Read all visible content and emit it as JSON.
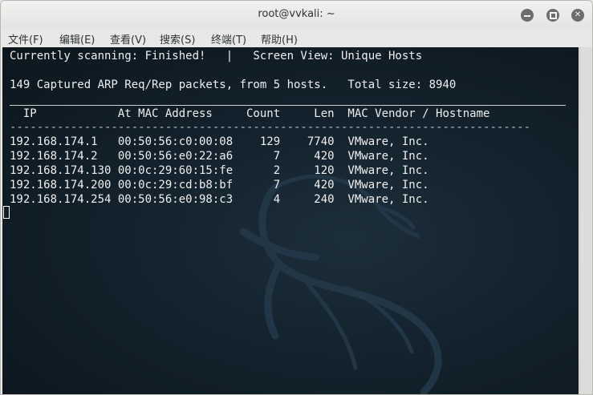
{
  "window": {
    "title": "root@vvkali: ~"
  },
  "menu": [
    "文件(F)",
    "编辑(E)",
    "查看(V)",
    "搜索(S)",
    "终端(T)",
    "帮助(H)"
  ],
  "terminal": {
    "status_line": "Currently scanning: Finished!   |   Screen View: Unique Hosts",
    "summary_line": "149 Captured ARP Req/Rep packets, from 5 hosts.   Total size: 8940",
    "header_line": "  IP            At MAC Address     Count     Len  MAC Vendor / Hostname",
    "dash_line": "-----------------------------------------------------------------------------",
    "rows": [
      "192.168.174.1   00:50:56:c0:00:08    129    7740  VMware, Inc.",
      "192.168.174.2   00:50:56:e0:22:a6      7     420  VMware, Inc.",
      "192.168.174.130 00:0c:29:60:15:fe      2     120  VMware, Inc.",
      "192.168.174.200 00:0c:29:cd:b8:bf      7     420  VMware, Inc.",
      "192.168.174.254 00:50:56:e0:98:c3      4     240  VMware, Inc."
    ]
  }
}
